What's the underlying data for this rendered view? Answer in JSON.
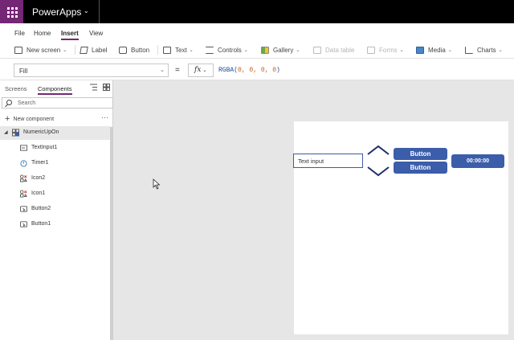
{
  "app": {
    "title": "PowerApps"
  },
  "menu": {
    "items": [
      "File",
      "Home",
      "Insert",
      "View"
    ],
    "active": "Insert"
  },
  "ribbon": {
    "new_screen": "New screen",
    "label": "Label",
    "button": "Button",
    "text": "Text",
    "controls": "Controls",
    "gallery": "Gallery",
    "data_table": "Data table",
    "forms": "Forms",
    "media": "Media",
    "charts": "Charts"
  },
  "formula": {
    "property": "Fill",
    "equals": "=",
    "fx": "fx",
    "expression_fn": "RGBA(",
    "expression_args": "0, 0, 0, 0",
    "expression_close": ")"
  },
  "panel": {
    "tabs": [
      "Screens",
      "Components"
    ],
    "active_tab": "Components",
    "search_placeholder": "Search",
    "new_component": "New component",
    "more": "···",
    "tree": {
      "root": "NumericUpOn",
      "children": [
        "TextInput1",
        "Timer1",
        "Icon2",
        "Icon1",
        "Button2",
        "Button1"
      ]
    }
  },
  "canvas": {
    "text_input": "Text input",
    "button_top": "Button",
    "button_bottom": "Button",
    "timer": "00:00:00"
  },
  "colors": {
    "brand": "#742774",
    "control_blue": "#3b5daa",
    "chevron_navy": "#1f2d6b",
    "canvas_bg": "#e6e6e6"
  }
}
